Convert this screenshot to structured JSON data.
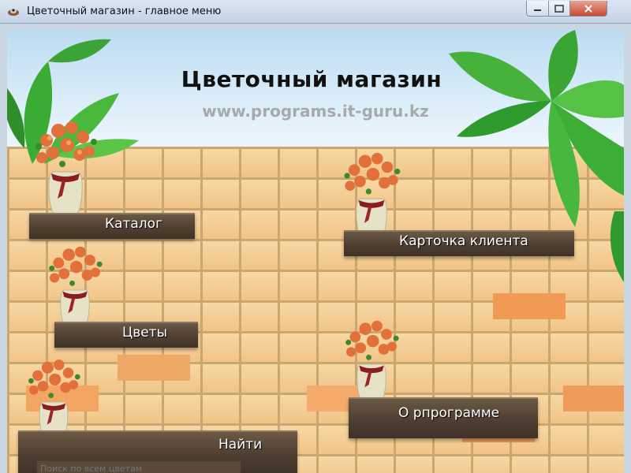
{
  "window": {
    "title": "Цветочный магазин - главное меню",
    "controls": [
      "minimize",
      "maximize",
      "close"
    ]
  },
  "header": {
    "title": "Цветочный магазин",
    "website": "www.programs.it-guru.kz"
  },
  "menu": {
    "catalog": "Каталог",
    "client_card": "Карточка клиента",
    "flowers": "Цветы",
    "about": "О рпрограмме",
    "search": "Найти"
  },
  "search": {
    "placeholder": "Поиск по всем цветам",
    "value": ""
  },
  "icons": [
    "app-icon",
    "minimize-icon",
    "maximize-icon",
    "close-icon",
    "flower-vase-icon",
    "leaves-decoration"
  ],
  "colors": {
    "sky": "#bcdcf2",
    "brick": "#f1c487",
    "shelf": "#4f3f31",
    "title_text": "#111111",
    "url_text": "#a7a9ad",
    "close_button": "#c64b33"
  }
}
